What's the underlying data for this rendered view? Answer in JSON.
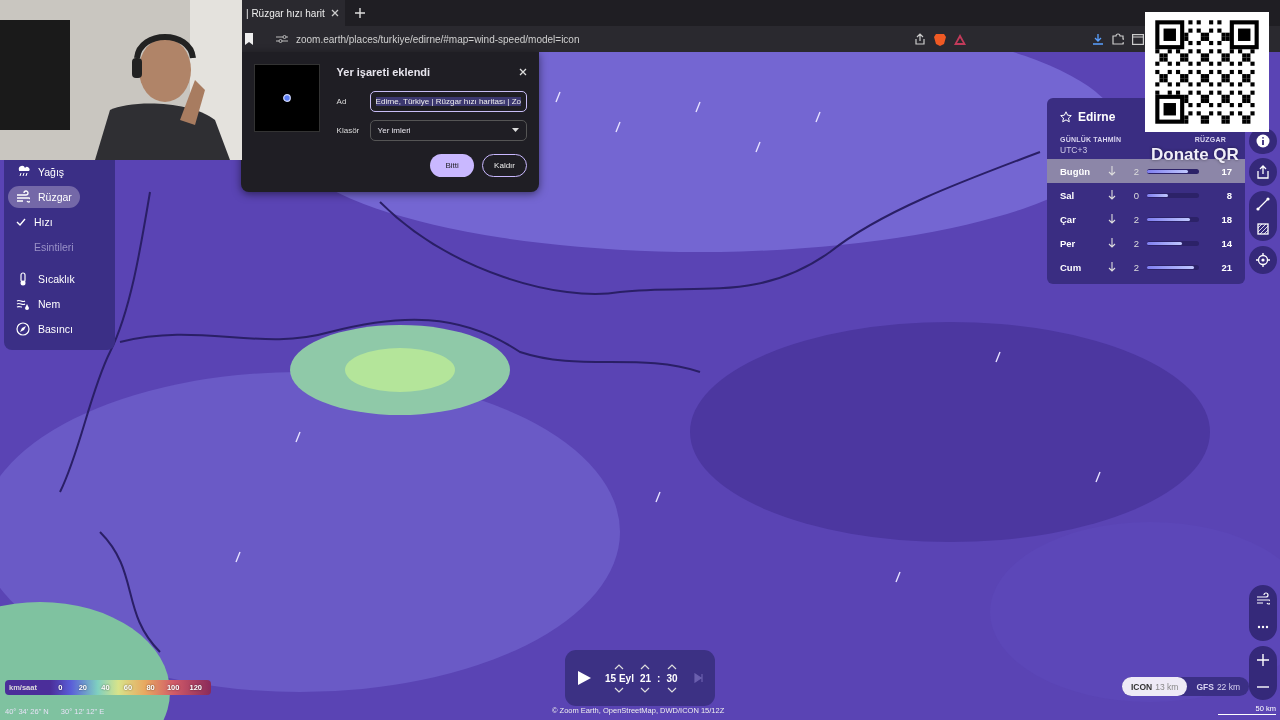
{
  "browser": {
    "tab": {
      "title": "| Rüzgar hızı harit",
      "selected": true
    },
    "address": "zoom.earth/places/turkiye/edirne/#map=wind-speed/model=icon"
  },
  "bookmark_dialog": {
    "title": "Yer işareti eklendi",
    "name_label": "Ad",
    "name_value": "Edirne, Türkiye | Rüzgar hızı haritası | Zo",
    "folder_label": "Klasör",
    "folder_value": "Yer imleri",
    "buttons": [
      {
        "label": "Bitti",
        "kind": "primary"
      },
      {
        "label": "Kaldır",
        "kind": "secondary"
      }
    ]
  },
  "layers": [
    {
      "label": "Yağış",
      "kind": "precipitation",
      "selected": false
    },
    {
      "label": "Rüzgar",
      "kind": "wind",
      "selected": true
    },
    {
      "label": "Hızı",
      "kind": "option",
      "checked": true
    },
    {
      "label": "Esintileri",
      "kind": "option",
      "checked": false
    },
    {
      "label": "Sıcaklık",
      "kind": "temperature",
      "selected": false
    },
    {
      "label": "Nem",
      "kind": "humidity",
      "selected": false
    },
    {
      "label": "Basıncı",
      "kind": "pressure",
      "selected": false
    }
  ],
  "forecast": {
    "place": "Edirne",
    "favorite": false,
    "heading": "GÜNLÜK TAHMİN",
    "timezone": "UTC+3",
    "column": "RÜZGAR",
    "days": [
      {
        "day": "Bugün",
        "min": "2",
        "max": "17",
        "level": 0.78,
        "selected": true
      },
      {
        "day": "Sal",
        "min": "0",
        "max": "8",
        "level": 0.4,
        "selected": false
      },
      {
        "day": "Çar",
        "min": "2",
        "max": "18",
        "level": 0.82,
        "selected": false
      },
      {
        "day": "Per",
        "min": "2",
        "max": "14",
        "level": 0.68,
        "selected": false
      },
      {
        "day": "Cum",
        "min": "2",
        "max": "21",
        "level": 0.9,
        "selected": false
      }
    ]
  },
  "overlay": {
    "label": "Donate QR"
  },
  "legend": {
    "unit": "km/saat",
    "ticks": [
      "0",
      "20",
      "40",
      "60",
      "80",
      "100",
      "120"
    ]
  },
  "coordinates": {
    "latitude": "40° 34' 26\" N",
    "longitude": "30° 12' 12\" E"
  },
  "timeline": {
    "date": "15 Eyl",
    "hour": "21",
    "separator": ":",
    "minute": "30",
    "playing": false
  },
  "attribution": "© Zoom Earth, OpenStreetMap, DWD/ICON 15/12Z",
  "models": [
    {
      "name": "ICON",
      "resolution": "13 km",
      "selected": true
    },
    {
      "name": "GFS",
      "resolution": "22 km",
      "selected": false
    }
  ],
  "scale": "50 km"
}
